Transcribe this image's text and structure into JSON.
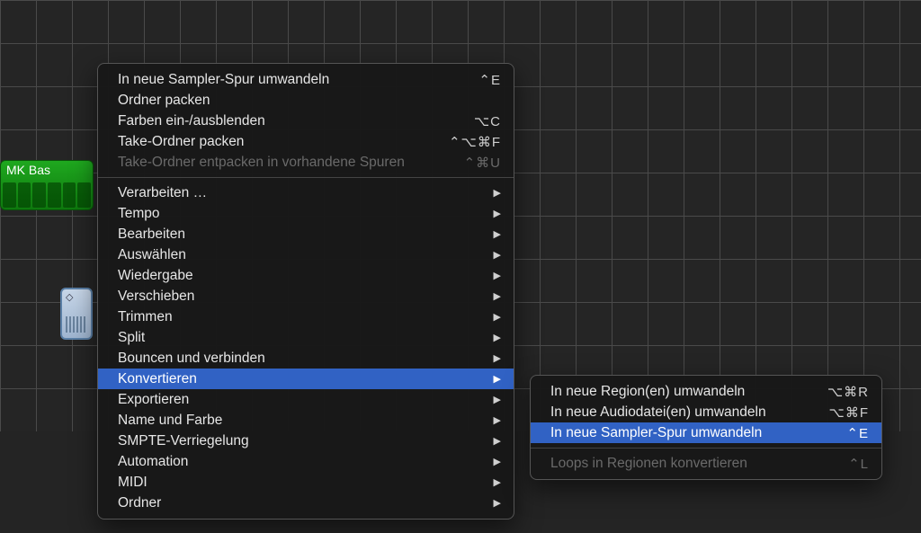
{
  "tracks": {
    "green_region_label": "MK Bas"
  },
  "menu": {
    "items": [
      {
        "label": "In neue Sampler-Spur umwandeln",
        "shortcut": "⌃E"
      },
      {
        "label": "Ordner packen"
      },
      {
        "label": "Farben ein-/ausblenden",
        "shortcut": "⌥C"
      },
      {
        "label": "Take-Ordner packen",
        "shortcut": "⌃⌥⌘F"
      },
      {
        "label": "Take-Ordner entpacken in vorhandene Spuren",
        "shortcut": "⌃⌘U",
        "disabled": true
      },
      {
        "sep": true
      },
      {
        "label": "Verarbeiten …",
        "submenu": true
      },
      {
        "label": "Tempo",
        "submenu": true
      },
      {
        "label": "Bearbeiten",
        "submenu": true
      },
      {
        "label": "Auswählen",
        "submenu": true
      },
      {
        "label": "Wiedergabe",
        "submenu": true
      },
      {
        "label": "Verschieben",
        "submenu": true
      },
      {
        "label": "Trimmen",
        "submenu": true
      },
      {
        "label": "Split",
        "submenu": true
      },
      {
        "label": "Bouncen und verbinden",
        "submenu": true
      },
      {
        "label": "Konvertieren",
        "submenu": true,
        "highlight": true
      },
      {
        "label": "Exportieren",
        "submenu": true
      },
      {
        "label": "Name und Farbe",
        "submenu": true
      },
      {
        "label": "SMPTE-Verriegelung",
        "submenu": true
      },
      {
        "label": "Automation",
        "submenu": true
      },
      {
        "label": "MIDI",
        "submenu": true
      },
      {
        "label": "Ordner",
        "submenu": true
      }
    ]
  },
  "submenu": {
    "items": [
      {
        "label": "In neue Region(en) umwandeln",
        "shortcut": "⌥⌘R"
      },
      {
        "label": "In neue Audiodatei(en) umwandeln",
        "shortcut": "⌥⌘F"
      },
      {
        "label": "In neue Sampler-Spur umwandeln",
        "shortcut": "⌃E",
        "highlight": true
      },
      {
        "sep": true
      },
      {
        "label": "Loops in Regionen konvertieren",
        "shortcut": "⌃L",
        "disabled": true
      }
    ]
  }
}
